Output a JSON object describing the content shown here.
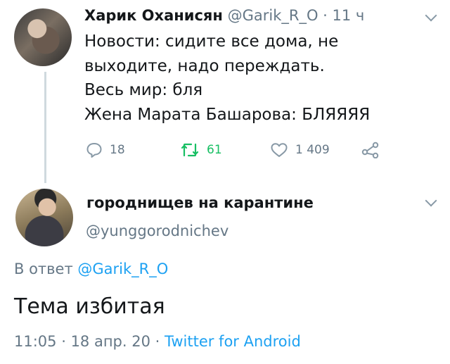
{
  "tweet": {
    "author_name": "Харик Оханисян",
    "author_handle": "@Garik_R_O",
    "separator": " · ",
    "time_ago": "11 ч",
    "lines": [
      "Новости: сидите все дома, не",
      "выходите, надо переждать.",
      "Весь мир: бля",
      "Жена Марата Башарова: БЛЯЯЯЯ"
    ],
    "actions": {
      "replies": "18",
      "retweets": "61",
      "likes": "1 409"
    }
  },
  "reply": {
    "author_name": "городнищев на карантине",
    "author_handle": "@yunggorodnichev",
    "reply_to_prefix": "В ответ",
    "reply_to_handle": "@Garik_R_O",
    "text": "Тема избитая",
    "time": "11:05",
    "date": "18 апр. 20",
    "dot": " · ",
    "source": "Twitter for Android"
  },
  "colors": {
    "text": "#14171a",
    "muted": "#657786",
    "link": "#1da1f2",
    "retweet": "#17bf63",
    "thread_line": "#cfd9de"
  },
  "icons": [
    "reply-icon",
    "retweet-icon",
    "like-icon",
    "share-icon",
    "chevron-down-icon"
  ]
}
